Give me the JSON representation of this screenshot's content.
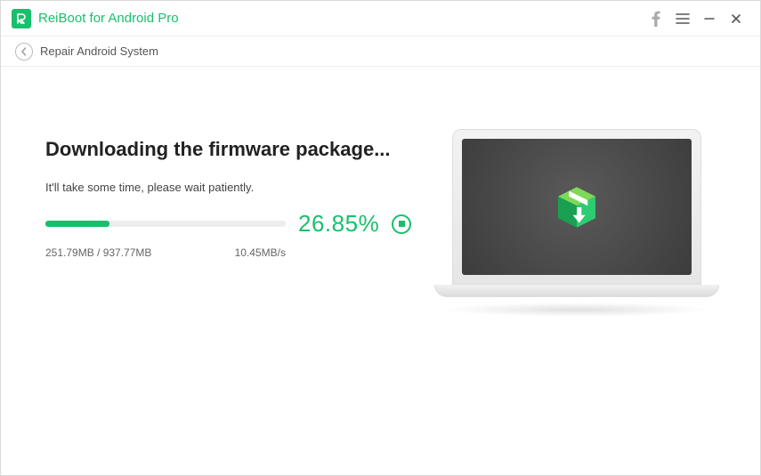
{
  "app": {
    "title": "ReiBoot for Android Pro"
  },
  "breadcrumb": {
    "label": "Repair Android System"
  },
  "main": {
    "heading": "Downloading the firmware package...",
    "subtext": "It'll take some time, please wait patiently.",
    "percent_label": "26.85%",
    "progress_percent": 26.85,
    "downloaded": "251.79MB / 937.77MB",
    "speed": "10.45MB/s"
  },
  "colors": {
    "accent": "#19bf6c"
  }
}
